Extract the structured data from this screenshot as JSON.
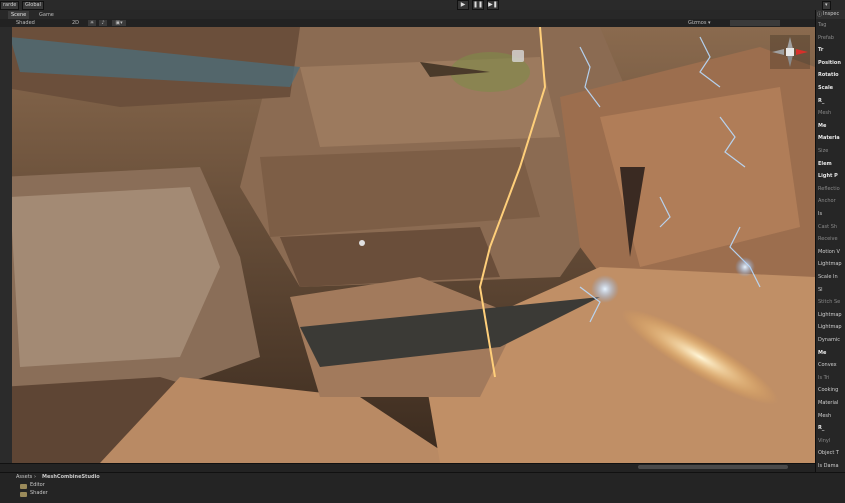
{
  "toolbar": {
    "left_tabs": [
      "rarde",
      "Global"
    ],
    "play_buttons": [
      "▶",
      "❚❚",
      "▶❚"
    ],
    "layout_label": "▾"
  },
  "scene_tabs": [
    {
      "label": "Scene",
      "active": true
    },
    {
      "label": "Game",
      "active": false
    }
  ],
  "scene_bar": {
    "shading_mode": "Shaded",
    "mode_2d": "2D",
    "gizmos_label": "Gizmos ▾"
  },
  "inspector": {
    "tab_label": "Inspec",
    "rows": [
      {
        "text": "Tag",
        "style": "dim"
      },
      {
        "text": "Prefab",
        "style": "dim"
      },
      {
        "text": "Tr",
        "style": "bold"
      },
      {
        "text": "Position",
        "style": "bold"
      },
      {
        "text": "Rotatio",
        "style": "bold"
      },
      {
        "text": "Scale",
        "style": "bold"
      },
      {
        "text": "R_",
        "style": "bold"
      },
      {
        "text": "Mesh",
        "style": "dim"
      },
      {
        "text": "Me",
        "style": "bold"
      },
      {
        "text": "Materia",
        "style": "bold"
      },
      {
        "text": "Size",
        "style": "dim"
      },
      {
        "text": "Elem",
        "style": "bold"
      },
      {
        "text": "Light P",
        "style": "bold"
      },
      {
        "text": "Reflectio",
        "style": "dim"
      },
      {
        "text": "Anchor",
        "style": "dim"
      },
      {
        "text": "Is",
        "style": "normal"
      },
      {
        "text": "Cast Sh",
        "style": "dim"
      },
      {
        "text": "Receive",
        "style": "dim"
      },
      {
        "text": "Motion V",
        "style": "normal"
      },
      {
        "text": "Lightmap",
        "style": "normal"
      },
      {
        "text": "Scale In",
        "style": "normal"
      },
      {
        "text": "Sl",
        "style": "normal"
      },
      {
        "text": "Stitch Se",
        "style": "dim"
      },
      {
        "text": "Lightmap",
        "style": "normal"
      },
      {
        "text": "Lightmap",
        "style": "normal"
      },
      {
        "text": "Dynamic",
        "style": "normal"
      },
      {
        "text": "Me",
        "style": "bold"
      },
      {
        "text": "Convex",
        "style": "normal"
      },
      {
        "text": "Is Tri",
        "style": "dim"
      },
      {
        "text": "Cooking",
        "style": "normal"
      },
      {
        "text": "Material",
        "style": "normal"
      },
      {
        "text": "Mesh",
        "style": "normal"
      },
      {
        "text": "R_",
        "style": "bold"
      },
      {
        "text": "Vinyl",
        "style": "dim"
      },
      {
        "text": "Object T",
        "style": "normal"
      },
      {
        "text": "Is Dama",
        "style": "normal"
      }
    ]
  },
  "project": {
    "breadcrumb": [
      "Assets",
      "MeshCombineStudio"
    ],
    "folders": [
      "Editor",
      "Shader"
    ]
  },
  "colors": {
    "accent": "#3d7bd9",
    "rock_light": "#b98a64",
    "rock_dark": "#4a3424",
    "lightning": "#9fd2ff",
    "fire": "#ffb84a"
  }
}
